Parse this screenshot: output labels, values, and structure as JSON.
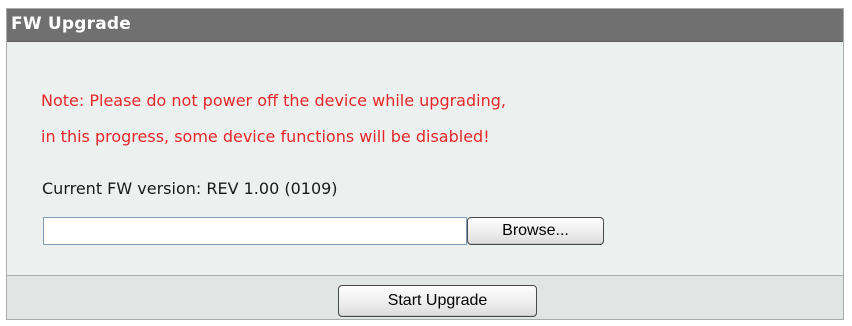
{
  "panel": {
    "title": "FW Upgrade"
  },
  "note": {
    "line1": "Note: Please do not power off the device while upgrading,",
    "line2": "in this progress, some device functions will be disabled!",
    "color": "#e6262a"
  },
  "firmware": {
    "current_version_text": "Current FW version: REV 1.00 (0109)"
  },
  "file_input": {
    "value": ""
  },
  "buttons": {
    "browse_label": "Browse...",
    "start_upgrade_label": "Start Upgrade"
  },
  "colors": {
    "header_bg": "#707070",
    "panel_bg": "#ecf1ef",
    "note_red": "#e6262a"
  }
}
